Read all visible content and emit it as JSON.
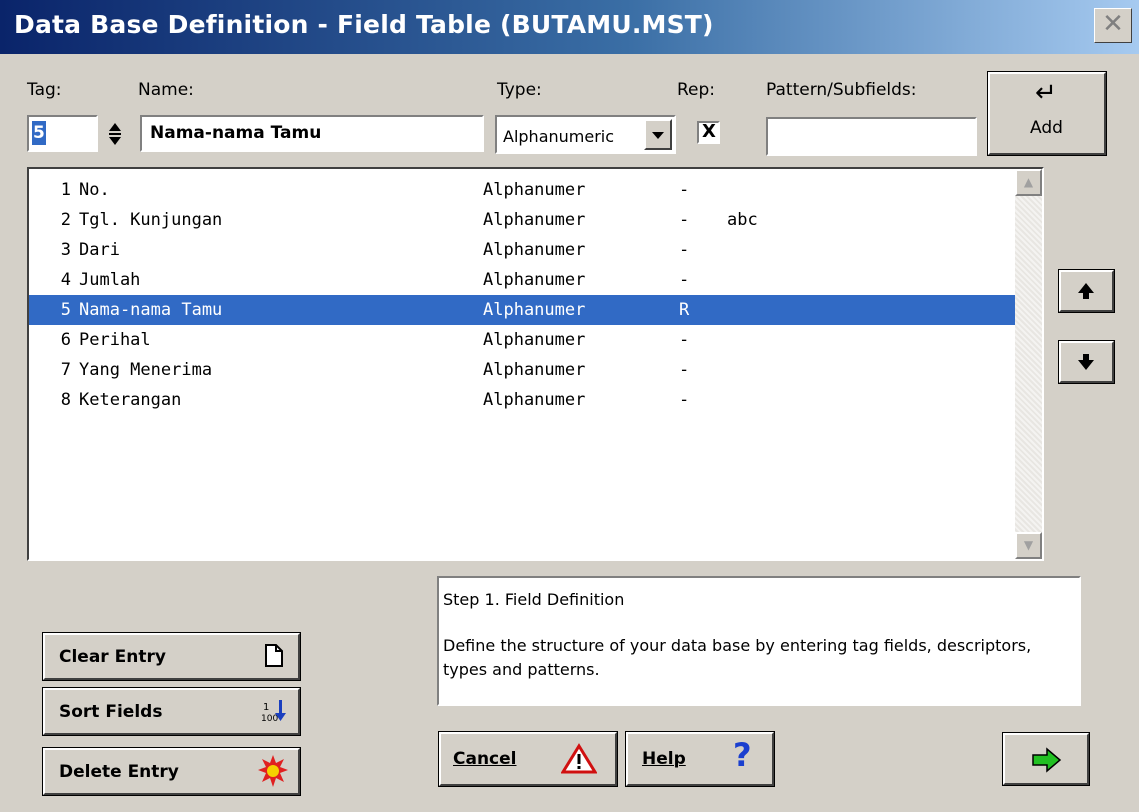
{
  "window": {
    "title": "Data Base Definition - Field Table (BUTAMU.MST)",
    "close_glyph": "✕"
  },
  "form": {
    "tag_label": "Tag:",
    "name_label": "Name:",
    "type_label": "Type:",
    "rep_label": "Rep:",
    "pattern_label": "Pattern/Subfields:",
    "tag_value": "5",
    "name_value": "Nama-nama Tamu",
    "type_value": "Alphanumeric",
    "rep_checked": true,
    "rep_mark": "X",
    "pattern_value": "",
    "add_glyph": "↵",
    "add_label": "Add"
  },
  "fields": [
    {
      "num": "1",
      "name": "No.",
      "type": "Alphanumer",
      "rep": "-",
      "pattern": ""
    },
    {
      "num": "2",
      "name": "Tgl. Kunjungan",
      "type": "Alphanumer",
      "rep": "-",
      "pattern": "abc"
    },
    {
      "num": "3",
      "name": "Dari",
      "type": "Alphanumer",
      "rep": "-",
      "pattern": ""
    },
    {
      "num": "4",
      "name": "Jumlah",
      "type": "Alphanumer",
      "rep": "-",
      "pattern": ""
    },
    {
      "num": "5",
      "name": "Nama-nama Tamu",
      "type": "Alphanumer",
      "rep": "R",
      "pattern": ""
    },
    {
      "num": "6",
      "name": "Perihal",
      "type": "Alphanumer",
      "rep": "-",
      "pattern": ""
    },
    {
      "num": "7",
      "name": "Yang Menerima",
      "type": "Alphanumer",
      "rep": "-",
      "pattern": ""
    },
    {
      "num": "8",
      "name": "Keterangan",
      "type": "Alphanumer",
      "rep": "-",
      "pattern": ""
    }
  ],
  "selected_index": 4,
  "description": {
    "line1": "Step 1. Field Definition",
    "line2": "Define the structure of your data base by entering tag fields, descriptors, types and patterns."
  },
  "buttons": {
    "clear": "Clear Entry",
    "sort": "Sort Fields",
    "delete": "Delete Entry",
    "cancel": "Cancel",
    "help": "Help",
    "help_glyph": "?",
    "next_glyph": "➡",
    "up_glyph": "🠕",
    "down_glyph": "🠗"
  },
  "colors": {
    "selection": "#316ac5",
    "titlebar": "#0a246a",
    "next_arrow": "#22c022"
  }
}
